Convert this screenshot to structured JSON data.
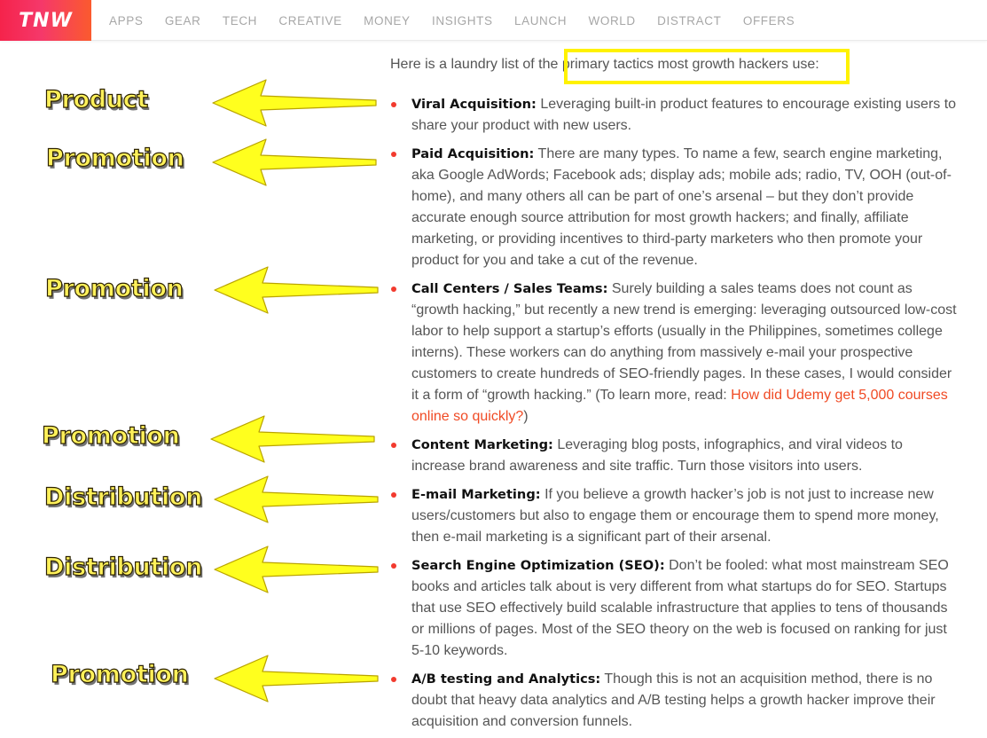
{
  "brand": {
    "logo_text": "TNW",
    "gradient_colors": [
      "#f5234b",
      "#fb5a2e"
    ]
  },
  "nav": {
    "items": [
      "APPS",
      "GEAR",
      "TECH",
      "CREATIVE",
      "MONEY",
      "INSIGHTS",
      "LAUNCH",
      "WORLD",
      "DISTRACT",
      "OFFERS"
    ]
  },
  "intro": {
    "text": "Here is a laundry list of the primary tactics most growth hackers use:"
  },
  "tactics": [
    {
      "title": "Viral Acquisition:",
      "body": "Leveraging built-in product features to encourage existing users to share your product with new users."
    },
    {
      "title": "Paid Acquisition:",
      "body": "There are many types. To name a few, search engine marketing, aka Google AdWords; Facebook ads; display ads; mobile ads; radio, TV, OOH (out-of-home), and many others all can be part of one’s arsenal – but they don’t provide accurate enough source attribution for most growth hackers; and finally, affiliate marketing, or providing incentives to third-party marketers who then promote your product for you and take a cut of the revenue."
    },
    {
      "title": "Call Centers / Sales Teams:",
      "body": "Surely building a sales teams does not count as “growth hacking,” but recently a new trend is emerging: leveraging outsourced low-cost labor to help support a startup’s efforts (usually in the Philippines, sometimes college interns). These workers can do anything from massively e-mail your prospective customers to create hundreds of SEO-friendly pages. In these cases, I would consider it a form of “growth hacking.” (To learn more, read:",
      "link": "How did Udemy get 5,000 courses online so quickly?",
      "tail": ")"
    },
    {
      "title": "Content Marketing:",
      "body": "Leveraging blog posts, infographics, and viral videos to increase brand awareness and site traffic. Turn those visitors into users."
    },
    {
      "title": "E-mail Marketing:",
      "body": "If you believe a growth hacker’s job is not just to increase new users/customers but also to engage them or encourage them to spend more money, then e-mail marketing is a significant part of their arsenal."
    },
    {
      "title": "Search Engine Optimization (SEO):",
      "body": "Don’t be fooled: what most mainstream SEO books and articles talk about is very different from what startups do for SEO. Startups that use SEO effectively build scalable infrastructure that applies to tens of thousands or millions of pages. Most of the SEO theory on the web is focused on ranking for just 5-10 keywords."
    },
    {
      "title": "A/B testing and Analytics:",
      "body": "Though this is not an acquisition method, there is no doubt that heavy data analytics and A/B testing helps a growth hacker improve their acquisition and conversion funnels."
    }
  ],
  "annotations": [
    "Product",
    "Promotion",
    "Promotion",
    "Promotion",
    "Distribution",
    "Distribution",
    "Promotion"
  ],
  "colors": {
    "annotation_fill": "#fff15a",
    "arrow_fill": "#ffff1e",
    "highlight_border": "#fff200",
    "bullet": "#f23a2e",
    "link": "#f04a24"
  }
}
